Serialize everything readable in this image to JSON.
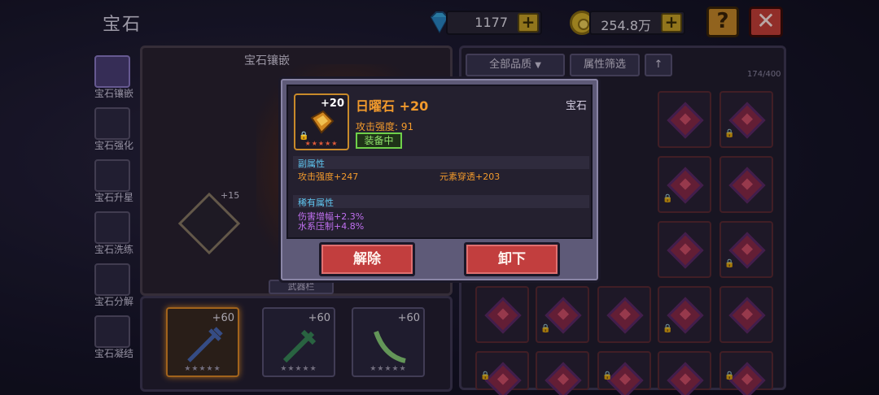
{
  "header": {
    "title": "宝石",
    "gems_count": "1177",
    "gold_amount": "254.8万",
    "plus_label": "+",
    "help_label": "?",
    "close_label": "✕"
  },
  "sidebar": {
    "items": [
      {
        "label": "宝石镶嵌",
        "active": true
      },
      {
        "label": "宝石强化"
      },
      {
        "label": "宝石升星"
      },
      {
        "label": "宝石洗练"
      },
      {
        "label": "宝石分解"
      },
      {
        "label": "宝石凝结"
      }
    ]
  },
  "inlay_panel": {
    "title": "宝石镶嵌",
    "slot_level": "+15",
    "weapon_tab": "武器栏"
  },
  "weapons": [
    {
      "level": "+60"
    },
    {
      "level": "+60"
    },
    {
      "level": "+60"
    }
  ],
  "inventory": {
    "quality_filter": "全部品质",
    "attr_filter": "属性筛选",
    "sort_arrow": "↑",
    "count": "174/400"
  },
  "popup": {
    "item_name": "日曜石 +20",
    "item_level": "+20",
    "item_type": "宝石",
    "main_stat": "攻击强度: 91",
    "equipped": "装备中",
    "sub_title": "副属性",
    "sub_stats": [
      "攻击强度+247",
      "元素穿透+203"
    ],
    "rare_title": "稀有属性",
    "rare_stats": [
      "伤害增幅+2.3%",
      "水系压制+4.8%"
    ],
    "unequip_label": "解除",
    "remove_label": "卸下"
  },
  "colors": {
    "accent_orange": "#f29a2c",
    "rare_purple": "#c070f0",
    "section_blue": "#5fc6f0",
    "button_red": "#c23e3e",
    "equipped_green": "#6fd04a"
  }
}
